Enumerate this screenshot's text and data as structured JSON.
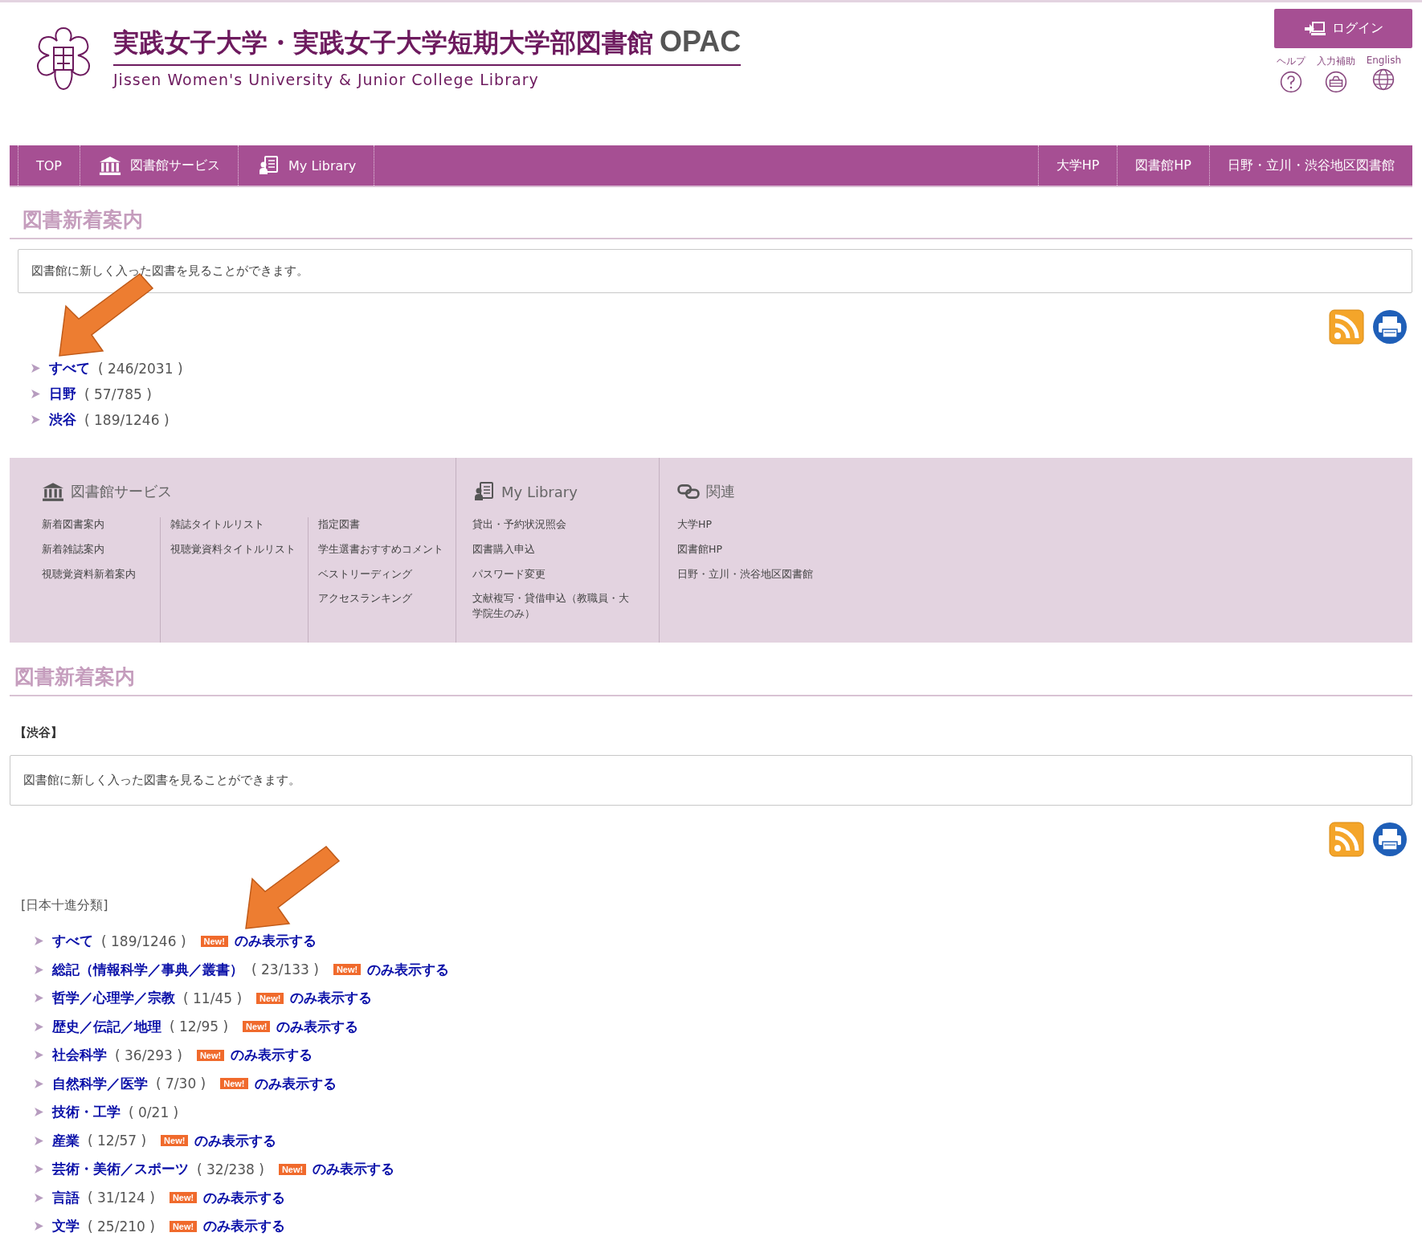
{
  "header": {
    "title": "実践女子大学・実践女子大学短期大学部図書館",
    "title_suffix": "OPAC",
    "subtitle": "Jissen Women's University & Junior College Library",
    "login": "ログイン",
    "utilities": [
      {
        "kind": "help",
        "label": "ヘルプ"
      },
      {
        "kind": "keyboard",
        "label": "入力補助"
      },
      {
        "kind": "globe",
        "label": "English"
      }
    ]
  },
  "nav": {
    "left": [
      {
        "kind": "text",
        "label": "TOP"
      },
      {
        "kind": "library",
        "label": "図書館サービス"
      },
      {
        "kind": "mylibrary",
        "label": "My Library"
      }
    ],
    "right": [
      "大学HP",
      "図書館HP",
      "日野・立川・渋谷地区図書館"
    ]
  },
  "section_top": {
    "heading": "図書新着案内",
    "description": "図書館に新しく入った図書を見ることができます。",
    "links": [
      {
        "name": "すべて",
        "count": "( 246/2031 )"
      },
      {
        "name": "日野",
        "count": "( 57/785 )"
      },
      {
        "name": "渋谷",
        "count": "( 189/1246 )"
      }
    ]
  },
  "footer_menu": [
    {
      "kind": "library",
      "title": "図書館サービス",
      "columns": [
        [
          "新着図書案内",
          "新着雑誌案内",
          "視聴覚資料新着案内"
        ],
        [
          "雑誌タイトルリスト",
          "視聴覚資料タイトルリスト"
        ],
        [
          "指定図書",
          "学生選書おすすめコメント",
          "ベストリーディング",
          "アクセスランキング"
        ]
      ]
    },
    {
      "kind": "mylibrary",
      "title": "My Library",
      "columns": [
        [
          "貸出・予約状況照会",
          "図書購入申込",
          "パスワード変更",
          "文献複写・貸借申込（教職員・大学院生のみ）"
        ]
      ]
    },
    {
      "kind": "related",
      "title": "関連",
      "columns": [
        [
          "大学HP",
          "図書館HP",
          "日野・立川・渋谷地区図書館"
        ]
      ]
    }
  ],
  "section_main": {
    "heading": "図書新着案内",
    "campus": "【渋谷】",
    "description": "図書館に新しく入った図書を見ることができます。",
    "classification": "[日本十進分類]",
    "items": [
      {
        "name": "すべて",
        "count": "( 189/1246 )",
        "new_badge": "New!",
        "new_link": "のみ表示する"
      },
      {
        "name": "総記（情報科学／事典／叢書）",
        "count": "( 23/133 )",
        "new_badge": "New!",
        "new_link": "のみ表示する"
      },
      {
        "name": "哲学／心理学／宗教",
        "count": "( 11/45 )",
        "new_badge": "New!",
        "new_link": "のみ表示する"
      },
      {
        "name": "歴史／伝記／地理",
        "count": "( 12/95 )",
        "new_badge": "New!",
        "new_link": "のみ表示する"
      },
      {
        "name": "社会科学",
        "count": "( 36/293 )",
        "new_badge": "New!",
        "new_link": "のみ表示する"
      },
      {
        "name": "自然科学／医学",
        "count": "( 7/30 )",
        "new_badge": "New!",
        "new_link": "のみ表示する"
      },
      {
        "name": "技術・工学",
        "count": "( 0/21 )"
      },
      {
        "name": "産業",
        "count": "( 12/57 )",
        "new_badge": "New!",
        "new_link": "のみ表示する"
      },
      {
        "name": "芸術・美術／スポーツ",
        "count": "( 32/238 )",
        "new_badge": "New!",
        "new_link": "のみ表示する"
      },
      {
        "name": "言語",
        "count": "( 31/124 )",
        "new_badge": "New!",
        "new_link": "のみ表示する"
      },
      {
        "name": "文学",
        "count": "( 25/210 )",
        "new_badge": "New!",
        "new_link": "のみ表示する"
      }
    ]
  }
}
